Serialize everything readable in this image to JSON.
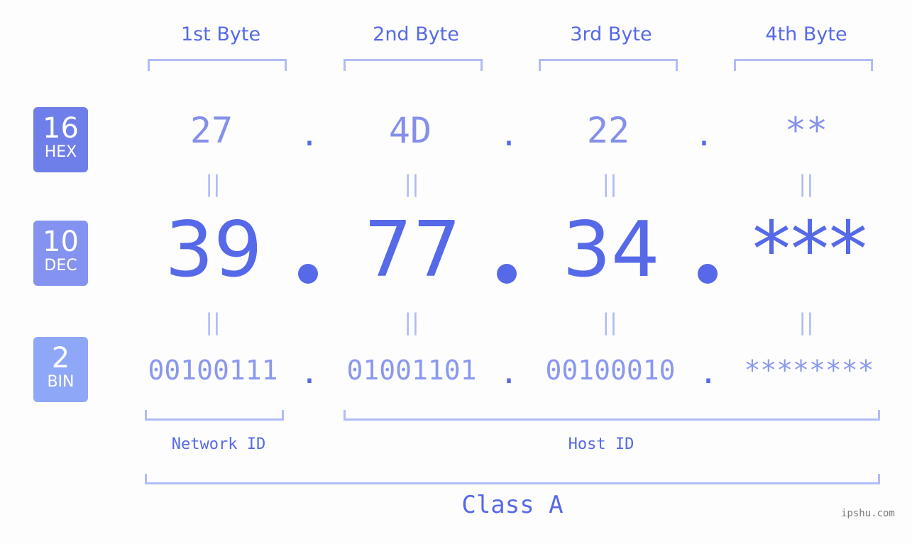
{
  "headers": [
    "1st Byte",
    "2nd Byte",
    "3rd Byte",
    "4th Byte"
  ],
  "badges": [
    {
      "num": "16",
      "label": "HEX",
      "color": "#6f7fe9"
    },
    {
      "num": "10",
      "label": "DEC",
      "color": "#8493f0"
    },
    {
      "num": "2",
      "label": "BIN",
      "color": "#8fa7f7"
    }
  ],
  "hex": [
    "27",
    "4D",
    "22",
    "**"
  ],
  "dec": [
    "39",
    "77",
    "34",
    "***"
  ],
  "bin": [
    "00100111",
    "01001101",
    "00100010",
    "********"
  ],
  "separator": ".",
  "equals": "||",
  "network_label": "Network ID",
  "host_label": "Host ID",
  "class_label": "Class A",
  "watermark": "ipshu.com"
}
